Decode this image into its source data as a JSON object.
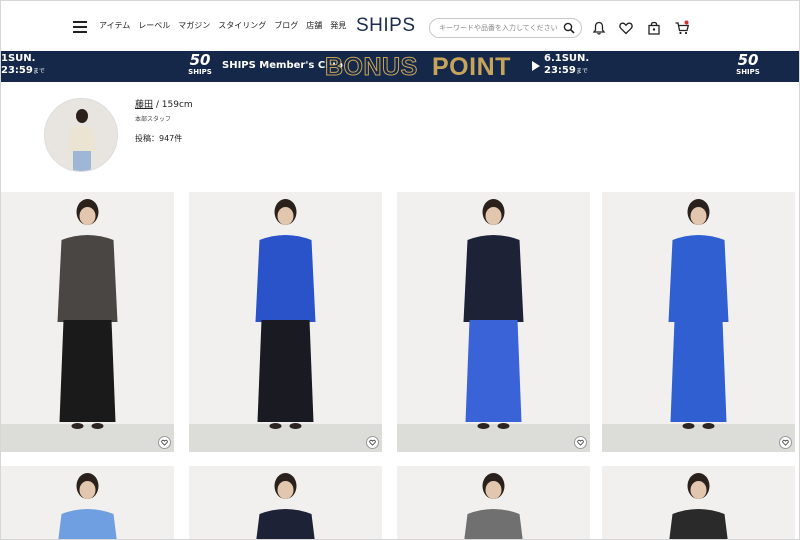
{
  "header": {
    "nav": [
      "アイテム",
      "レーベル",
      "マガジン",
      "スタイリング",
      "ブログ",
      "店舗",
      "発見"
    ],
    "logo": "SHIPS",
    "search_placeholder": "キーワードや品番を入力してください",
    "icons": [
      "menu-icon",
      "search-icon",
      "bell-icon",
      "heart-icon",
      "bag-icon",
      "cart-icon"
    ]
  },
  "banner": {
    "left_date": "1SUN.",
    "left_time": "23:59",
    "left_suffix": "まで",
    "anniv_num": "50",
    "anniv_brand": "SHIPS",
    "club": "SHIPS Member's Club",
    "bonus": "BONUS",
    "point": "POINT",
    "right_date": "6.1SUN.",
    "right_time": "23:59",
    "right_suffix": "まで",
    "colors": {
      "navy": "#16284a",
      "gold": "#c6a55a"
    }
  },
  "profile": {
    "name": "藤田",
    "height": "/ 159cm",
    "role": "本部スタッフ",
    "posts": "投稿：947件"
  },
  "grid": {
    "card_icon": "heart-icon",
    "cards": [
      {
        "name": "look-gray-jacket-black-pants",
        "top": "#4a4644",
        "bottom": "#1a1a1a"
      },
      {
        "name": "look-blue-shirt-black-pants",
        "top": "#2a52c9",
        "bottom": "#1a1a22"
      },
      {
        "name": "look-navy-jacket-blue-skirt",
        "top": "#1d2236",
        "bottom": "#3b63d8"
      },
      {
        "name": "look-blue-shirt-dress",
        "top": "#2f5fd0",
        "bottom": "#2f5fd0"
      },
      {
        "name": "look-light-blue-top",
        "top": "#6f9fe0",
        "bottom": "#6f9fe0"
      },
      {
        "name": "look-navy-hoodie",
        "top": "#1d2236",
        "bottom": "#1d2236"
      },
      {
        "name": "look-gray-dot-top",
        "top": "#707070",
        "bottom": "#707070"
      },
      {
        "name": "look-black-lace-top",
        "top": "#2a2a2a",
        "bottom": "#2a2a2a"
      }
    ]
  }
}
